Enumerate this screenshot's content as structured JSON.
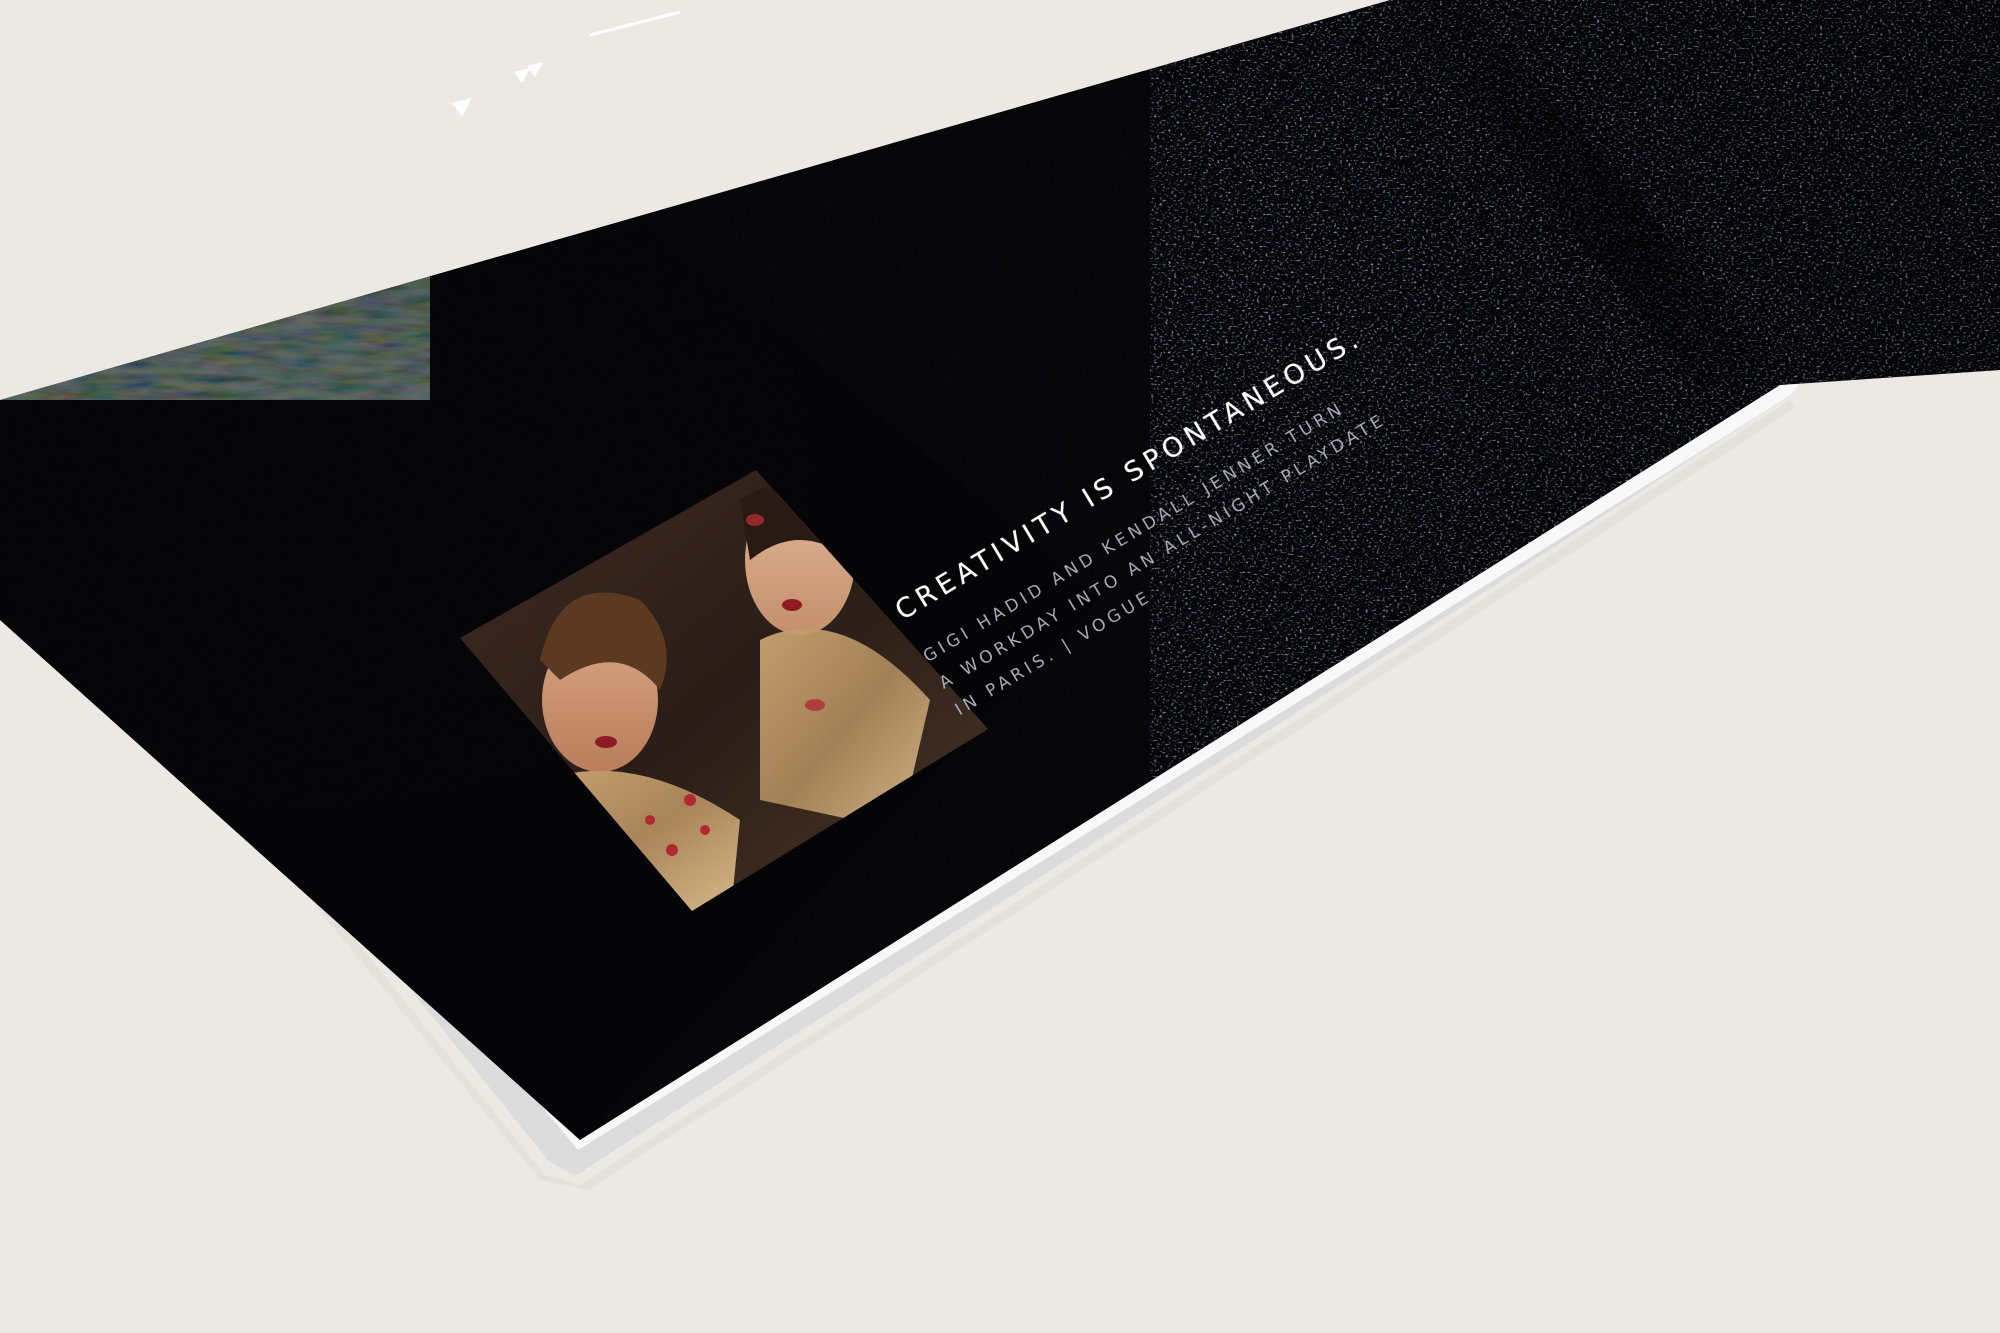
{
  "spread": {
    "video_controls": {
      "play_icon": "play-icon",
      "fast_forward_icon": "fast-forward-icon"
    },
    "headline": "CREATIVITY IS SPONTANEOUS.",
    "caption_lines": [
      "GIGI HADID AND KENDALL JENNER TURN",
      "A WORKDAY INTO AN ALL-NIGHT PLAYDATE",
      "IN PARIS. | VOGUE"
    ]
  }
}
